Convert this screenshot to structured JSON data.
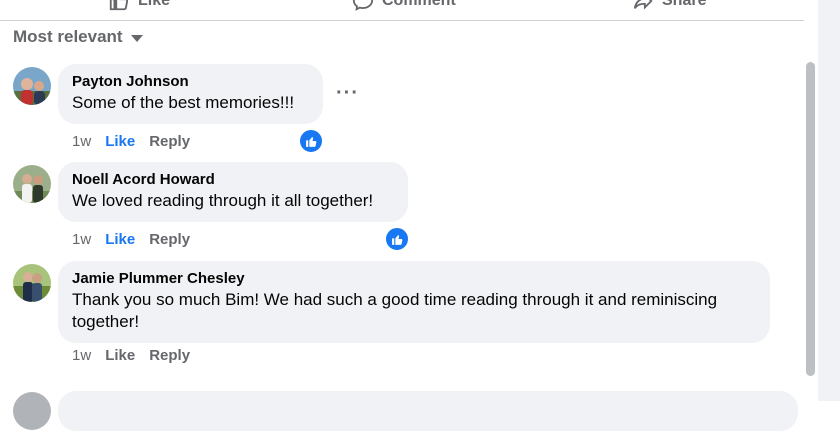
{
  "actions": {
    "like_label": "Like",
    "comment_label": "Comment",
    "share_label": "Share"
  },
  "sort": {
    "label": "Most relevant",
    "icon": "caret-down-icon"
  },
  "comments": [
    {
      "author": "Payton Johnson",
      "text": "Some of the best memories!!!",
      "time": "1w",
      "like_label": "Like",
      "reply_label": "Reply",
      "liked": true,
      "reaction_icon": "thumbs-up-icon",
      "more_label": "···"
    },
    {
      "author": "Noell Acord Howard",
      "text": "We loved reading through it all together!",
      "time": "1w",
      "like_label": "Like",
      "reply_label": "Reply",
      "liked": true,
      "reaction_icon": "thumbs-up-icon"
    },
    {
      "author": "Jamie Plummer Chesley",
      "text": "Thank you so much Bim! We had such a good time reading through it and reminiscing together!",
      "time": "1w",
      "like_label": "Like",
      "reply_label": "Reply",
      "liked": false
    }
  ],
  "colors": {
    "accent": "#1877f2",
    "bubble": "#f0f2f5",
    "secondary_text": "#65676b"
  }
}
